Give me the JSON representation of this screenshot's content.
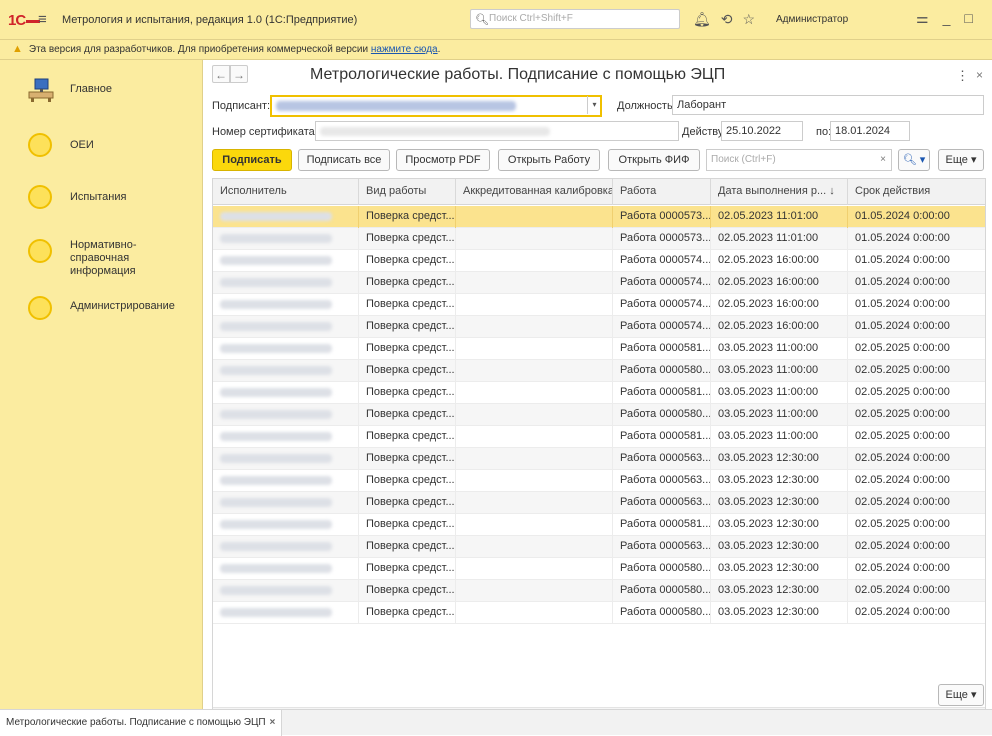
{
  "titlebar": {
    "logo": "1С",
    "title": "Метрология и испытания, редакция 1.0 (1С:Предприятие)",
    "search_placeholder": "Поиск Ctrl+Shift+F",
    "user": "Администратор"
  },
  "warning": {
    "text": "Эта версия для разработчиков. Для приобретения коммерческой версии",
    "link": "нажмите сюда",
    "link_suffix": "."
  },
  "sidebar": {
    "items": [
      {
        "label": "Главное"
      },
      {
        "label": "ОЕИ"
      },
      {
        "label": "Испытания"
      },
      {
        "label": "Нормативно-справочная информация"
      },
      {
        "label": "Администрирование"
      }
    ]
  },
  "form": {
    "title": "Метрологические работы. Подписание с помощью ЭЦП",
    "menu_icon": "⋮",
    "close_icon": "×",
    "signer_label": "Подписант:",
    "position_label": "Должность:",
    "position_value": "Лаборант",
    "cert_label": "Номер сертификата:",
    "valid_from_label": "Действует с:",
    "valid_from": "25.10.2022",
    "valid_to_label": "по:",
    "valid_to": "18.01.2024",
    "search_placeholder": "Поиск (Ctrl+F)"
  },
  "toolbar": {
    "sign": "Подписать",
    "sign_all": "Подписать все",
    "view_pdf": "Просмотр PDF",
    "open_work": "Открыть Работу",
    "open_fif": "Открыть ФИФ",
    "more": "Еще"
  },
  "table": {
    "columns": [
      "Исполнитель",
      "Вид работы",
      "Аккредитованная калибровка",
      "Работа",
      "Дата выполнения р...",
      "Срок действия"
    ],
    "sort_indicator": "↓",
    "rows": [
      {
        "type": "Поверка средст...",
        "work": "Работа 0000573...",
        "date": "02.05.2023 11:01:00",
        "valid": "01.05.2024 0:00:00"
      },
      {
        "type": "Поверка средст...",
        "work": "Работа 0000573...",
        "date": "02.05.2023 11:01:00",
        "valid": "01.05.2024 0:00:00"
      },
      {
        "type": "Поверка средст...",
        "work": "Работа 0000574...",
        "date": "02.05.2023 16:00:00",
        "valid": "01.05.2024 0:00:00"
      },
      {
        "type": "Поверка средст...",
        "work": "Работа 0000574...",
        "date": "02.05.2023 16:00:00",
        "valid": "01.05.2024 0:00:00"
      },
      {
        "type": "Поверка средст...",
        "work": "Работа 0000574...",
        "date": "02.05.2023 16:00:00",
        "valid": "01.05.2024 0:00:00"
      },
      {
        "type": "Поверка средст...",
        "work": "Работа 0000574...",
        "date": "02.05.2023 16:00:00",
        "valid": "01.05.2024 0:00:00"
      },
      {
        "type": "Поверка средст...",
        "work": "Работа 0000581...",
        "date": "03.05.2023 11:00:00",
        "valid": "02.05.2025 0:00:00"
      },
      {
        "type": "Поверка средст...",
        "work": "Работа 0000580...",
        "date": "03.05.2023 11:00:00",
        "valid": "02.05.2025 0:00:00"
      },
      {
        "type": "Поверка средст...",
        "work": "Работа 0000581...",
        "date": "03.05.2023 11:00:00",
        "valid": "02.05.2025 0:00:00"
      },
      {
        "type": "Поверка средст...",
        "work": "Работа 0000580...",
        "date": "03.05.2023 11:00:00",
        "valid": "02.05.2025 0:00:00"
      },
      {
        "type": "Поверка средст...",
        "work": "Работа 0000581...",
        "date": "03.05.2023 11:00:00",
        "valid": "02.05.2025 0:00:00"
      },
      {
        "type": "Поверка средст...",
        "work": "Работа 0000563...",
        "date": "03.05.2023 12:30:00",
        "valid": "02.05.2024 0:00:00"
      },
      {
        "type": "Поверка средст...",
        "work": "Работа 0000563...",
        "date": "03.05.2023 12:30:00",
        "valid": "02.05.2024 0:00:00"
      },
      {
        "type": "Поверка средст...",
        "work": "Работа 0000563...",
        "date": "03.05.2023 12:30:00",
        "valid": "02.05.2024 0:00:00"
      },
      {
        "type": "Поверка средст...",
        "work": "Работа 0000581...",
        "date": "03.05.2023 12:30:00",
        "valid": "02.05.2025 0:00:00"
      },
      {
        "type": "Поверка средст...",
        "work": "Работа 0000563...",
        "date": "03.05.2023 12:30:00",
        "valid": "02.05.2024 0:00:00"
      },
      {
        "type": "Поверка средст...",
        "work": "Работа 0000580...",
        "date": "03.05.2023 12:30:00",
        "valid": "02.05.2024 0:00:00"
      },
      {
        "type": "Поверка средст...",
        "work": "Работа 0000580...",
        "date": "03.05.2023 12:30:00",
        "valid": "02.05.2024 0:00:00"
      },
      {
        "type": "Поверка средст...",
        "work": "Работа 0000580...",
        "date": "03.05.2023 12:30:00",
        "valid": "02.05.2024 0:00:00"
      }
    ]
  },
  "bottom_tab": {
    "label": "Метрологические работы. Подписание с помощью ЭЦП",
    "close": "×"
  },
  "colors": {
    "accent_yellow": "#fbd80c",
    "panel_yellow": "#fbeca0",
    "selected_row": "#fbe38e",
    "brand_red": "#d0232a"
  }
}
